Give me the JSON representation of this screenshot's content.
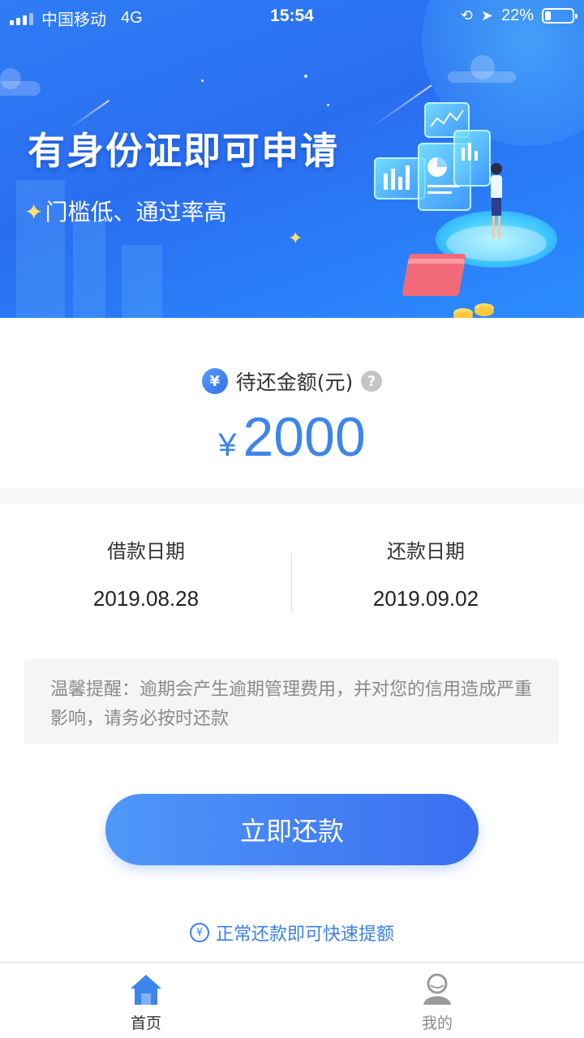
{
  "status_bar": {
    "carrier": "中国移动",
    "network": "4G",
    "time": "15:54",
    "battery": "22%",
    "battery_level": 0.22
  },
  "banner": {
    "title": "有身份证即可申请",
    "subtitle": "门槛低、通过率高"
  },
  "repayment": {
    "label": "待还金额(元)",
    "currency_symbol": "¥",
    "amount": "2000",
    "help_symbol": "?"
  },
  "dates": {
    "loan_label": "借款日期",
    "loan_date": "2019.08.28",
    "repay_label": "还款日期",
    "repay_date": "2019.09.02"
  },
  "notice": {
    "text": "温馨提醒：逾期会产生逾期管理费用，并对您的信用造成严重影响，请务必按时还款"
  },
  "actions": {
    "repay_button": "立即还款",
    "tip": "正常还款即可快速提额"
  },
  "tabbar": {
    "home_label": "首页",
    "mine_label": "我的"
  },
  "colors": {
    "accent": "#3d85ea",
    "banner": "#2f7cf6",
    "button_start": "#4f97f8",
    "button_end": "#3a6ff1"
  }
}
